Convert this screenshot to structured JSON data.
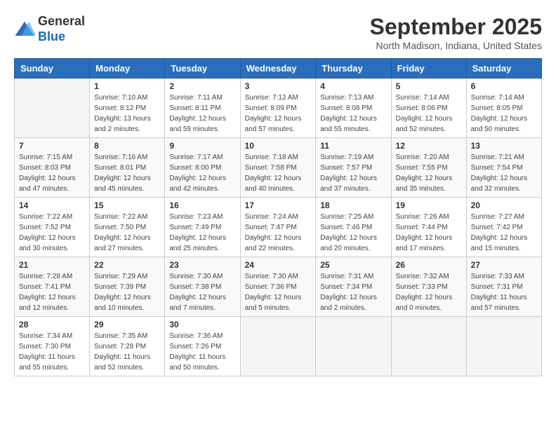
{
  "logo": {
    "line1": "General",
    "line2": "Blue"
  },
  "title": "September 2025",
  "location": "North Madison, Indiana, United States",
  "days_of_week": [
    "Sunday",
    "Monday",
    "Tuesday",
    "Wednesday",
    "Thursday",
    "Friday",
    "Saturday"
  ],
  "weeks": [
    [
      {
        "day": "",
        "info": ""
      },
      {
        "day": "1",
        "info": "Sunrise: 7:10 AM\nSunset: 8:12 PM\nDaylight: 13 hours\nand 2 minutes."
      },
      {
        "day": "2",
        "info": "Sunrise: 7:11 AM\nSunset: 8:11 PM\nDaylight: 12 hours\nand 59 minutes."
      },
      {
        "day": "3",
        "info": "Sunrise: 7:12 AM\nSunset: 8:09 PM\nDaylight: 12 hours\nand 57 minutes."
      },
      {
        "day": "4",
        "info": "Sunrise: 7:13 AM\nSunset: 8:08 PM\nDaylight: 12 hours\nand 55 minutes."
      },
      {
        "day": "5",
        "info": "Sunrise: 7:14 AM\nSunset: 8:06 PM\nDaylight: 12 hours\nand 52 minutes."
      },
      {
        "day": "6",
        "info": "Sunrise: 7:14 AM\nSunset: 8:05 PM\nDaylight: 12 hours\nand 50 minutes."
      }
    ],
    [
      {
        "day": "7",
        "info": "Sunrise: 7:15 AM\nSunset: 8:03 PM\nDaylight: 12 hours\nand 47 minutes."
      },
      {
        "day": "8",
        "info": "Sunrise: 7:16 AM\nSunset: 8:01 PM\nDaylight: 12 hours\nand 45 minutes."
      },
      {
        "day": "9",
        "info": "Sunrise: 7:17 AM\nSunset: 8:00 PM\nDaylight: 12 hours\nand 42 minutes."
      },
      {
        "day": "10",
        "info": "Sunrise: 7:18 AM\nSunset: 7:58 PM\nDaylight: 12 hours\nand 40 minutes."
      },
      {
        "day": "11",
        "info": "Sunrise: 7:19 AM\nSunset: 7:57 PM\nDaylight: 12 hours\nand 37 minutes."
      },
      {
        "day": "12",
        "info": "Sunrise: 7:20 AM\nSunset: 7:55 PM\nDaylight: 12 hours\nand 35 minutes."
      },
      {
        "day": "13",
        "info": "Sunrise: 7:21 AM\nSunset: 7:54 PM\nDaylight: 12 hours\nand 32 minutes."
      }
    ],
    [
      {
        "day": "14",
        "info": "Sunrise: 7:22 AM\nSunset: 7:52 PM\nDaylight: 12 hours\nand 30 minutes."
      },
      {
        "day": "15",
        "info": "Sunrise: 7:22 AM\nSunset: 7:50 PM\nDaylight: 12 hours\nand 27 minutes."
      },
      {
        "day": "16",
        "info": "Sunrise: 7:23 AM\nSunset: 7:49 PM\nDaylight: 12 hours\nand 25 minutes."
      },
      {
        "day": "17",
        "info": "Sunrise: 7:24 AM\nSunset: 7:47 PM\nDaylight: 12 hours\nand 22 minutes."
      },
      {
        "day": "18",
        "info": "Sunrise: 7:25 AM\nSunset: 7:46 PM\nDaylight: 12 hours\nand 20 minutes."
      },
      {
        "day": "19",
        "info": "Sunrise: 7:26 AM\nSunset: 7:44 PM\nDaylight: 12 hours\nand 17 minutes."
      },
      {
        "day": "20",
        "info": "Sunrise: 7:27 AM\nSunset: 7:42 PM\nDaylight: 12 hours\nand 15 minutes."
      }
    ],
    [
      {
        "day": "21",
        "info": "Sunrise: 7:28 AM\nSunset: 7:41 PM\nDaylight: 12 hours\nand 12 minutes."
      },
      {
        "day": "22",
        "info": "Sunrise: 7:29 AM\nSunset: 7:39 PM\nDaylight: 12 hours\nand 10 minutes."
      },
      {
        "day": "23",
        "info": "Sunrise: 7:30 AM\nSunset: 7:38 PM\nDaylight: 12 hours\nand 7 minutes."
      },
      {
        "day": "24",
        "info": "Sunrise: 7:30 AM\nSunset: 7:36 PM\nDaylight: 12 hours\nand 5 minutes."
      },
      {
        "day": "25",
        "info": "Sunrise: 7:31 AM\nSunset: 7:34 PM\nDaylight: 12 hours\nand 2 minutes."
      },
      {
        "day": "26",
        "info": "Sunrise: 7:32 AM\nSunset: 7:33 PM\nDaylight: 12 hours\nand 0 minutes."
      },
      {
        "day": "27",
        "info": "Sunrise: 7:33 AM\nSunset: 7:31 PM\nDaylight: 11 hours\nand 57 minutes."
      }
    ],
    [
      {
        "day": "28",
        "info": "Sunrise: 7:34 AM\nSunset: 7:30 PM\nDaylight: 11 hours\nand 55 minutes."
      },
      {
        "day": "29",
        "info": "Sunrise: 7:35 AM\nSunset: 7:28 PM\nDaylight: 11 hours\nand 52 minutes."
      },
      {
        "day": "30",
        "info": "Sunrise: 7:36 AM\nSunset: 7:26 PM\nDaylight: 11 hours\nand 50 minutes."
      },
      {
        "day": "",
        "info": ""
      },
      {
        "day": "",
        "info": ""
      },
      {
        "day": "",
        "info": ""
      },
      {
        "day": "",
        "info": ""
      }
    ]
  ]
}
